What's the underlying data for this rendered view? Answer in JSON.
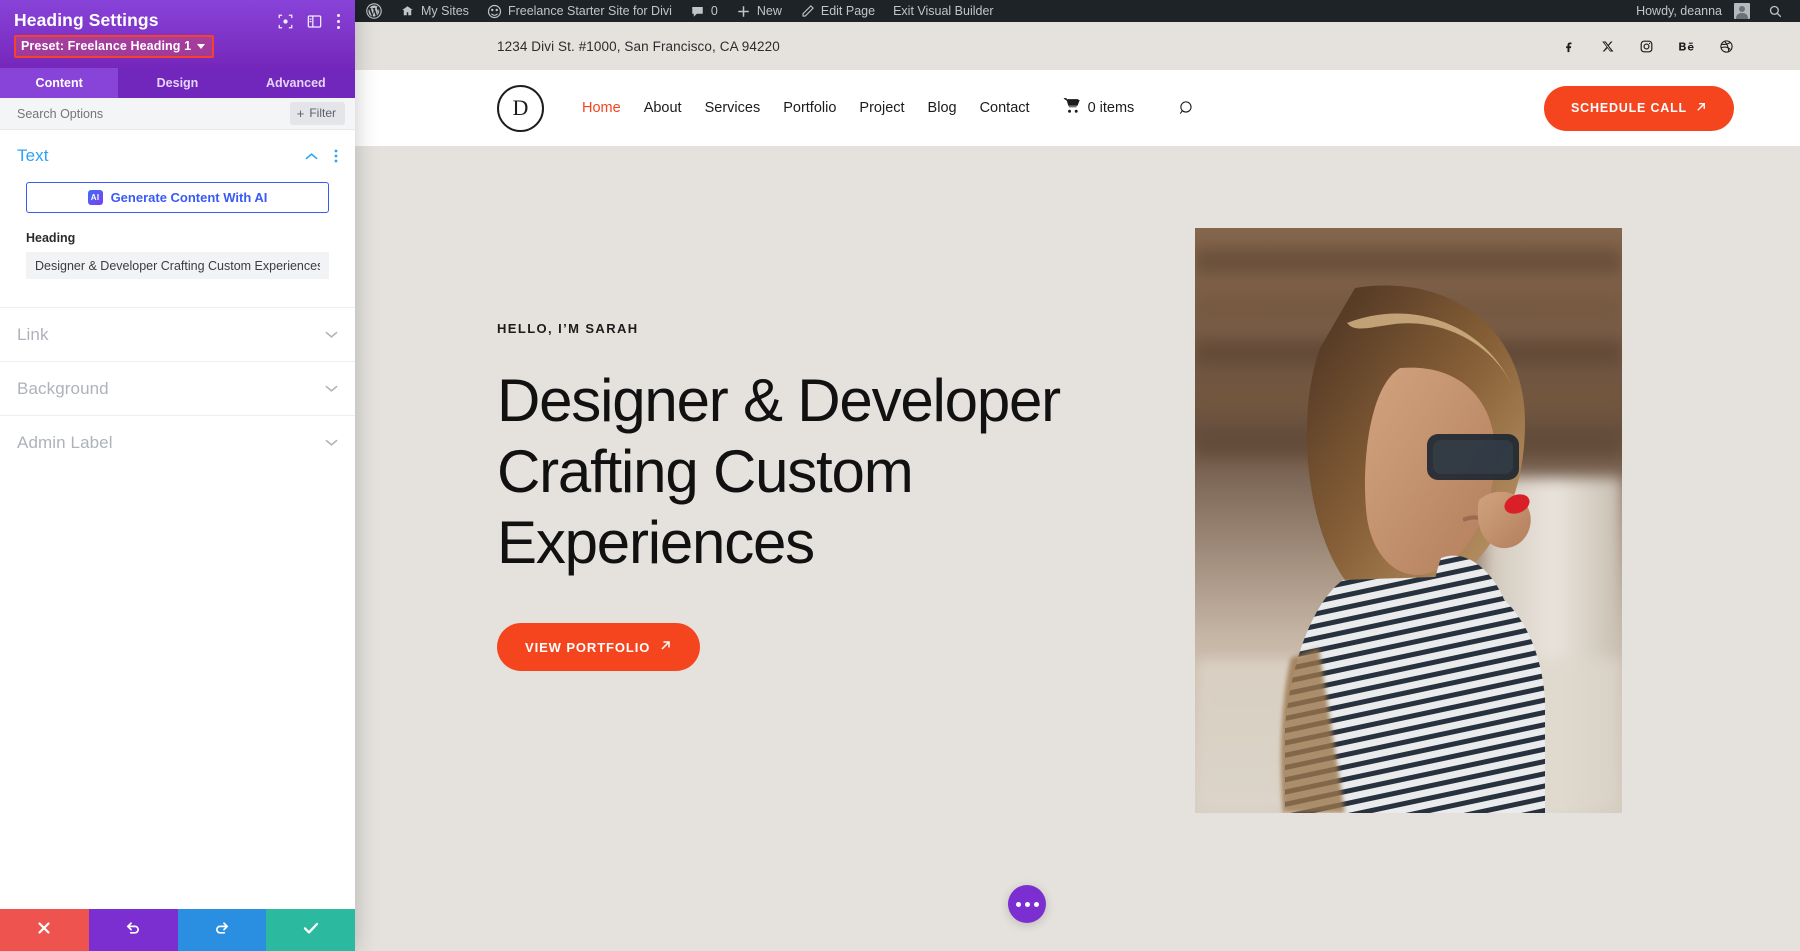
{
  "adminbar": {
    "wp_logo": "wordpress-icon",
    "my_sites": "My Sites",
    "site_name": "Freelance Starter Site for Divi",
    "comment_count": "0",
    "new": "New",
    "edit_page": "Edit Page",
    "exit_builder": "Exit Visual Builder",
    "howdy": "Howdy, deanna"
  },
  "panel": {
    "title": "Heading Settings",
    "preset": "Preset: Freelance Heading 1",
    "tabs": [
      {
        "label": "Content",
        "active": true
      },
      {
        "label": "Design",
        "active": false
      },
      {
        "label": "Advanced",
        "active": false
      }
    ],
    "search_placeholder": "Search Options",
    "filter_label": "Filter",
    "filter_plus": "+",
    "text_group": {
      "title": "Text",
      "ai_button": "Generate Content With AI",
      "ai_badge": "AI",
      "heading_label": "Heading",
      "heading_value": "Designer & Developer Crafting Custom Experiences"
    },
    "collapsed_groups": [
      {
        "label": "Link"
      },
      {
        "label": "Background"
      },
      {
        "label": "Admin Label"
      }
    ],
    "footer": [
      {
        "name": "discard",
        "icon": "close-icon",
        "color": "#ef5350"
      },
      {
        "name": "undo",
        "icon": "undo-icon",
        "color": "#7b2fd0"
      },
      {
        "name": "redo",
        "icon": "redo-icon",
        "color": "#2a8fe0"
      },
      {
        "name": "save",
        "icon": "check-icon",
        "color": "#2bb9a0"
      }
    ]
  },
  "site": {
    "address": "1234 Divi St. #1000, San Francisco, CA 94220",
    "social": [
      "facebook-icon",
      "x-twitter-icon",
      "instagram-icon",
      "behance-icon",
      "dribbble-icon"
    ],
    "logo_letter": "D",
    "nav": [
      {
        "label": "Home",
        "current": true
      },
      {
        "label": "About",
        "current": false
      },
      {
        "label": "Services",
        "current": false
      },
      {
        "label": "Portfolio",
        "current": false
      },
      {
        "label": "Project",
        "current": false
      },
      {
        "label": "Blog",
        "current": false
      },
      {
        "label": "Contact",
        "current": false
      }
    ],
    "cart_label": "0 items",
    "cta_label": "SCHEDULE CALL",
    "hero": {
      "eyebrow": "HELLO, I’M SARAH",
      "title": "Designer & Developer Crafting Custom Experiences",
      "button": "VIEW PORTFOLIO"
    }
  },
  "colors": {
    "divi_purple": "#8843d8",
    "accent_orange": "#f5451f",
    "page_bg": "#e5e2de",
    "link_blue": "#2ea3f2",
    "highlight_red": "#f9402a"
  }
}
